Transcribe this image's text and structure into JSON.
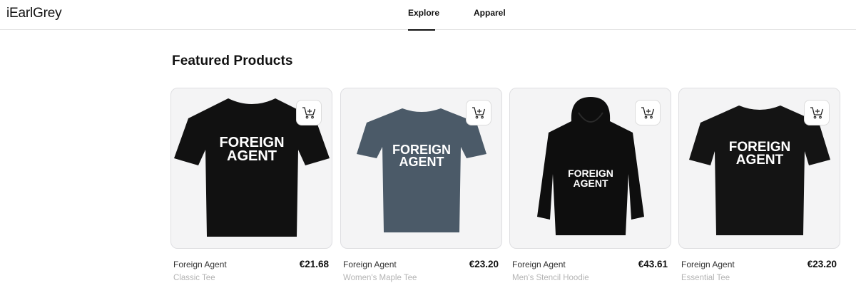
{
  "header": {
    "logo": "iEarlGrey",
    "nav": [
      {
        "label": "Explore",
        "active": true
      },
      {
        "label": "Apparel",
        "active": false
      }
    ]
  },
  "main": {
    "section_title": "Featured Products",
    "products": [
      {
        "name": "Foreign Agent",
        "variant": "Classic Tee",
        "price": "€21.68",
        "print": [
          "FOREIGN",
          "AGENT"
        ],
        "garment_color": "#111111",
        "garment": "tee"
      },
      {
        "name": "Foreign Agent",
        "variant": "Women's Maple Tee",
        "price": "€23.20",
        "print": [
          "FOREIGN",
          "AGENT"
        ],
        "garment_color": "#4b5a68",
        "garment": "tee"
      },
      {
        "name": "Foreign Agent",
        "variant": "Men's Stencil Hoodie",
        "price": "€43.61",
        "print": [
          "FOREIGN",
          "AGENT"
        ],
        "garment_color": "#0e0e0e",
        "garment": "hoodie"
      },
      {
        "name": "Foreign Agent",
        "variant": "Essential Tee",
        "price": "€23.20",
        "print": [
          "FOREIGN",
          "AGENT"
        ],
        "garment_color": "#141414",
        "garment": "tee"
      }
    ],
    "add_to_cart_icon": "cart-plus-icon"
  }
}
